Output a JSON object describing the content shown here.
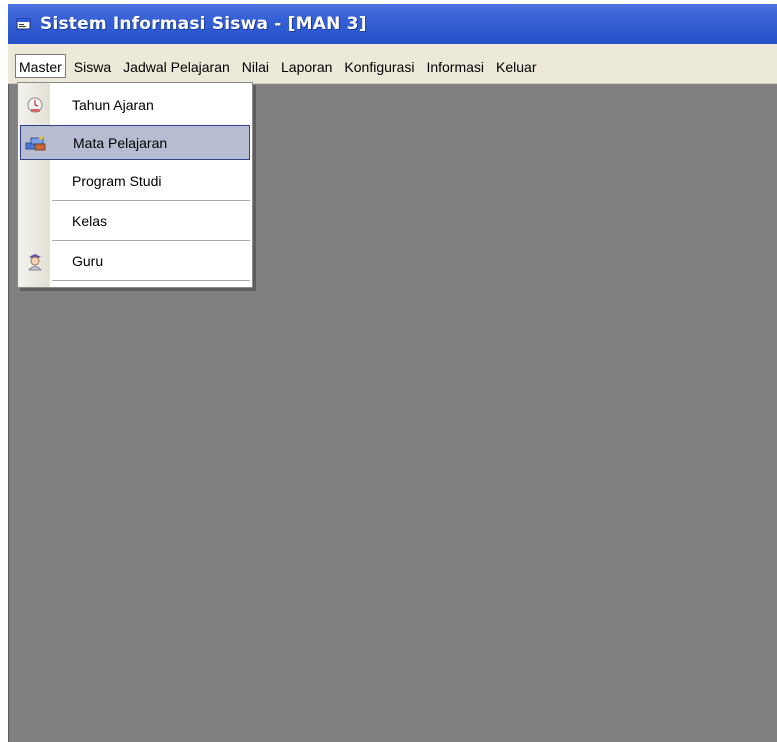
{
  "window": {
    "title": "Sistem Informasi Siswa - [MAN 3]",
    "app_icon": "window-app-icon"
  },
  "menubar": {
    "items": [
      {
        "label": "Master",
        "active": true
      },
      {
        "label": "Siswa"
      },
      {
        "label": "Jadwal Pelajaran"
      },
      {
        "label": "Nilai"
      },
      {
        "label": "Laporan"
      },
      {
        "label": "Konfigurasi"
      },
      {
        "label": "Informasi"
      },
      {
        "label": "Keluar"
      }
    ]
  },
  "master_menu": {
    "items": [
      {
        "label": "Tahun Ajaran",
        "icon": "calendar-clock-icon"
      },
      {
        "label": "Mata Pelajaran",
        "icon": "books-icon",
        "highlighted": true
      },
      {
        "label": "Program Studi",
        "icon": ""
      },
      {
        "label": "Kelas",
        "icon": ""
      },
      {
        "label": "Guru",
        "icon": "teacher-icon"
      }
    ]
  },
  "colors": {
    "titlebar": "#2450c8",
    "mdi_background": "#808080",
    "highlight": "#b6bdd2",
    "highlight_border": "#31418a"
  }
}
